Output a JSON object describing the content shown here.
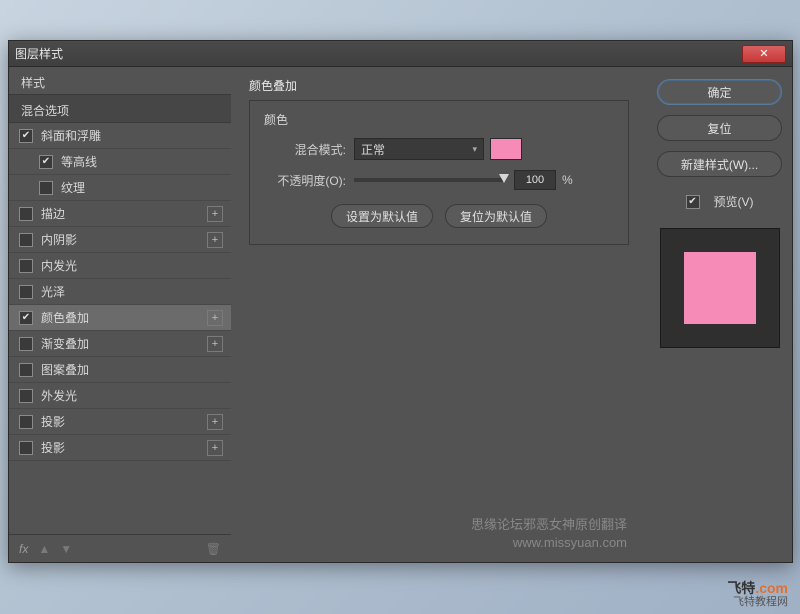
{
  "dialog": {
    "title": "图层样式"
  },
  "left": {
    "styles_header": "样式",
    "blend_header": "混合选项",
    "items": [
      {
        "label": "斜面和浮雕",
        "checked": true,
        "add": false,
        "sub": false
      },
      {
        "label": "等高线",
        "checked": true,
        "add": false,
        "sub": true
      },
      {
        "label": "纹理",
        "checked": false,
        "add": false,
        "sub": true
      },
      {
        "label": "描边",
        "checked": false,
        "add": true,
        "sub": false
      },
      {
        "label": "内阴影",
        "checked": false,
        "add": true,
        "sub": false
      },
      {
        "label": "内发光",
        "checked": false,
        "add": false,
        "sub": false
      },
      {
        "label": "光泽",
        "checked": false,
        "add": false,
        "sub": false
      },
      {
        "label": "颜色叠加",
        "checked": true,
        "add": true,
        "sub": false,
        "selected": true
      },
      {
        "label": "渐变叠加",
        "checked": false,
        "add": true,
        "sub": false
      },
      {
        "label": "图案叠加",
        "checked": false,
        "add": false,
        "sub": false
      },
      {
        "label": "外发光",
        "checked": false,
        "add": false,
        "sub": false
      },
      {
        "label": "投影",
        "checked": false,
        "add": true,
        "sub": false
      },
      {
        "label": "投影",
        "checked": false,
        "add": true,
        "sub": false
      }
    ],
    "footer_fx": "fx"
  },
  "panel": {
    "title": "颜色叠加",
    "subtitle": "颜色",
    "blend_label": "混合模式:",
    "blend_value": "正常",
    "opacity_label": "不透明度(O):",
    "opacity_value": "100",
    "opacity_unit": "%",
    "swatch_color": "#f78bb8",
    "set_default": "设置为默认值",
    "reset_default": "复位为默认值"
  },
  "right": {
    "ok": "确定",
    "cancel": "复位",
    "new_style": "新建样式(W)...",
    "preview_label": "预览(V)"
  },
  "watermark": {
    "line1": "思缘论坛邪恶女神原创翻译",
    "line2": "www.missyuan.com"
  },
  "logo": {
    "main": "飞特",
    "dot": ".com",
    "sub": "飞特教程网"
  }
}
